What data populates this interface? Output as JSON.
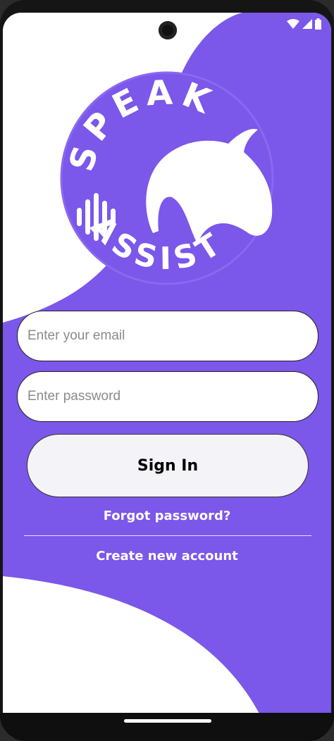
{
  "colors": {
    "accent": "#7b57ea",
    "background": "#ffffff",
    "button": "#f4f3f8"
  },
  "status_bar": {
    "icons": [
      "wifi-icon",
      "signal-icon",
      "battery-icon"
    ]
  },
  "logo": {
    "top_text": "SPEAK",
    "bottom_text": "ASSIST",
    "icons": [
      "sound-wave-icon",
      "dolphin-icon"
    ]
  },
  "form": {
    "email_placeholder": "Enter your email",
    "password_placeholder": "Enter password",
    "signin_label": "Sign In",
    "forgot_label": "Forgot password?",
    "create_label": "Create new account"
  }
}
